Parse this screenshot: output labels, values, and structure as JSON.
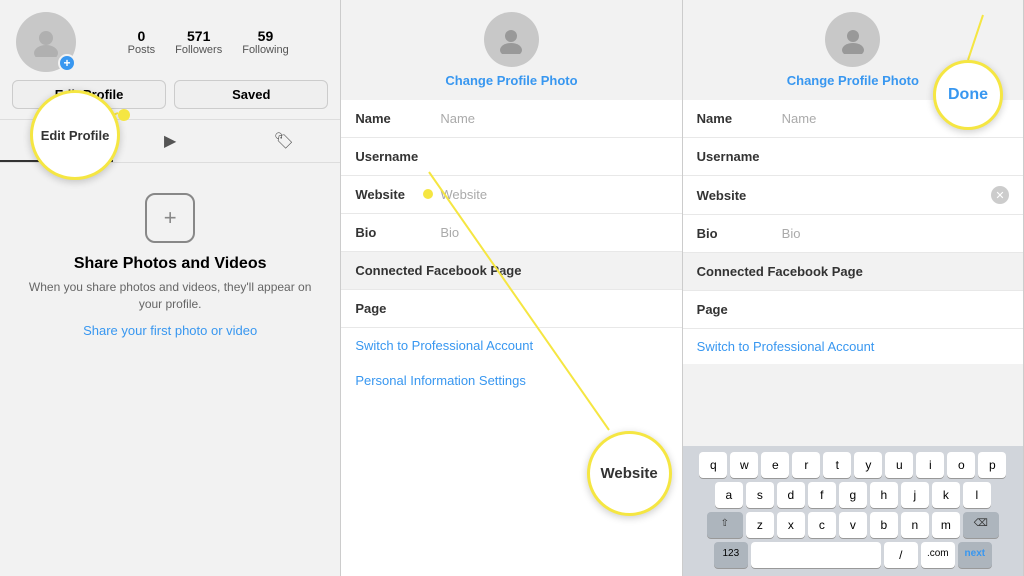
{
  "panel1": {
    "stats": [
      {
        "label": "Posts",
        "value": "0"
      },
      {
        "label": "Followers",
        "value": "571"
      },
      {
        "label": "Following",
        "value": "59"
      }
    ],
    "edit_button": "Edit Profile",
    "saved_button": "Saved",
    "share_title": "Share Photos and Videos",
    "share_desc": "When you share photos and videos, they'll appear on your profile.",
    "share_link": "Share your first photo or video",
    "annotation_label": "Edit Profile"
  },
  "panel2": {
    "change_photo": "Change Profile Photo",
    "fields": [
      {
        "label": "Name",
        "placeholder": "Name"
      },
      {
        "label": "Username",
        "placeholder": ""
      },
      {
        "label": "Website",
        "placeholder": "Website"
      },
      {
        "label": "Bio",
        "placeholder": "Bio"
      }
    ],
    "section1": "Connected Facebook Page",
    "section2": "Page",
    "link1": "Switch to Professional Account",
    "link2": "Personal Information Settings",
    "annotation_label": "Website"
  },
  "panel3": {
    "change_photo": "Change Profile Photo",
    "fields": [
      {
        "label": "Name",
        "placeholder": "Name"
      },
      {
        "label": "Username",
        "placeholder": ""
      },
      {
        "label": "Website",
        "placeholder": ""
      },
      {
        "label": "Bio",
        "placeholder": "Bio"
      }
    ],
    "section1": "Connected Facebook Page",
    "section2": "Page",
    "link1": "Switch to Professional Account",
    "annotation_label": "Done",
    "keyboard": {
      "rows": [
        [
          "q",
          "w",
          "e",
          "r",
          "t",
          "y",
          "u",
          "i",
          "o",
          "p"
        ],
        [
          "a",
          "s",
          "d",
          "f",
          "g",
          "h",
          "j",
          "k",
          "l"
        ],
        [
          "z",
          "x",
          "c",
          "v",
          "b",
          "n",
          "m"
        ]
      ],
      "bottom": [
        "123",
        "space",
        "/",
        ".com",
        "next"
      ]
    }
  }
}
